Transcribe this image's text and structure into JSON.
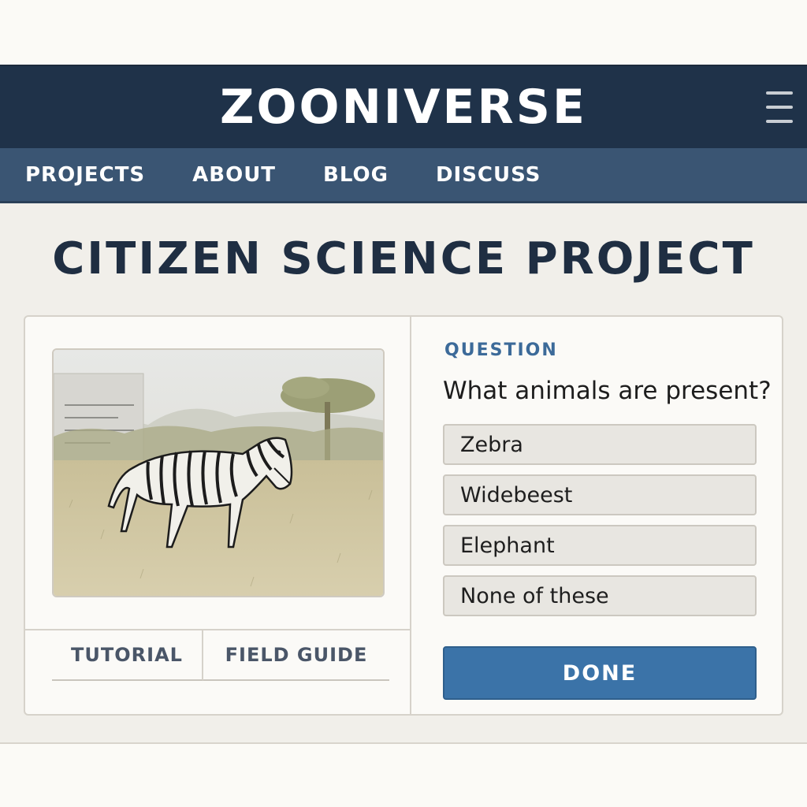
{
  "header": {
    "brand": "ZOONIVERSE",
    "menu_icon": "hamburger-menu-icon"
  },
  "nav": {
    "items": [
      {
        "label": "PROJECTS"
      },
      {
        "label": "ABOUT"
      },
      {
        "label": "BLOG"
      },
      {
        "label": "DISCUSS"
      }
    ]
  },
  "page": {
    "title": "CITIZEN SCIENCE PROJECT"
  },
  "subject": {
    "image_subject": "zebra-walking-in-savanna"
  },
  "tabs": [
    {
      "label": "TUTORIAL"
    },
    {
      "label": "FIELD GUIDE"
    }
  ],
  "task": {
    "label": "QUESTION",
    "question": "What animals are present?",
    "answers": [
      {
        "label": "Zebra"
      },
      {
        "label": "Widebeest"
      },
      {
        "label": "Elephant"
      },
      {
        "label": "None of these"
      }
    ],
    "done_label": "DONE"
  },
  "colors": {
    "header_bg": "#1f3249",
    "nav_bg": "#3a5573",
    "accent": "#3b73a8",
    "question_label": "#3c6a99"
  }
}
